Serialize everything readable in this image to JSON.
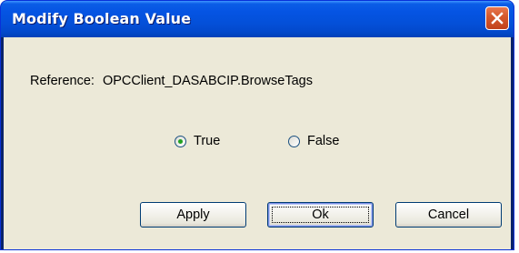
{
  "window": {
    "title": "Modify Boolean Value",
    "close_icon": "close-icon"
  },
  "reference": {
    "label": "Reference:",
    "value": "OPCClient_DASABCIP.BrowseTags"
  },
  "options": {
    "true_label": "True",
    "false_label": "False",
    "selected": "True"
  },
  "buttons": {
    "apply": "Apply",
    "ok": "Ok",
    "cancel": "Cancel"
  },
  "colors": {
    "titlebar": "#0554e3",
    "client": "#ece9d8",
    "close_button": "#d65a2e",
    "radio_dot": "#21a121"
  }
}
